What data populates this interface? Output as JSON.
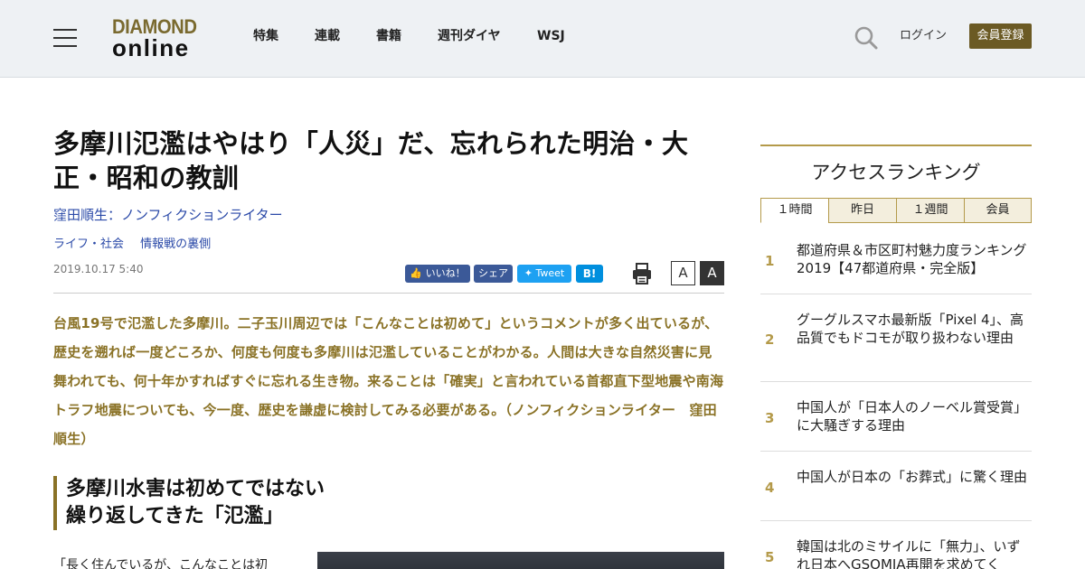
{
  "header": {
    "logo_top": "DIAMOND",
    "logo_bottom": "online",
    "nav": [
      "特集",
      "連載",
      "書籍",
      "週刊ダイヤ",
      "WSJ"
    ],
    "login": "ログイン",
    "register": "会員登録"
  },
  "article": {
    "title": "多摩川氾濫はやはり「人災」だ、忘れられた明治・大正・昭和の教訓",
    "author": "窪田順生：ノンフィクションライター",
    "categories": [
      "ライフ・社会",
      "情報戦の裏側"
    ],
    "date": "2019.10.17 5:40",
    "share": {
      "like": "いいね！",
      "fb_share": "シェア",
      "tweet": "Tweet",
      "hatena": "B!"
    },
    "font_small": "A",
    "font_large": "A",
    "lead": "台風19号で氾濫した多摩川。二子玉川周辺では「こんなことは初めて」というコメントが多く出ているが、歴史を遡れば一度どころか、何度も何度も多摩川は氾濫していることがわかる。人間は大きな自然災害に見舞われても、何十年かすればすぐに忘れる生き物。来ることは「確実」と言われている首都直下型地震や南海トラフ地震についても、今一度、歴史を謙虚に検討してみる必要がある。（ノンフィクションライター　窪田順生）",
    "heading_line1": "多摩川水害は初めてではない",
    "heading_line2": "繰り返してきた「氾濫」",
    "body_start": "「長く住んでいるが、こんなことは初"
  },
  "sidebar": {
    "title": "アクセスランキング",
    "tabs": [
      "１時間",
      "昨日",
      "１週間",
      "会員"
    ],
    "active_tab": "１時間",
    "items": [
      {
        "rank": "1",
        "text": "都道府県＆市区町村魅力度ランキング2019【47都道府県・完全版】"
      },
      {
        "rank": "2",
        "text": "グーグルスマホ最新版「Pixel 4」、高品質でもドコモが取り扱わない理由"
      },
      {
        "rank": "3",
        "text": "中国人が「日本人のノーベル賞受賞」に大騒ぎする理由"
      },
      {
        "rank": "4",
        "text": "中国人が日本の「お葬式」に驚く理由"
      },
      {
        "rank": "5",
        "text": "韓国は北のミサイルに「無力」、いずれ日本へGSOMIA再開を求めてく"
      }
    ]
  },
  "colors": {
    "accent_gold": "#8a7226",
    "link_blue": "#2b4aa8",
    "register_bg": "#6b5a24"
  }
}
